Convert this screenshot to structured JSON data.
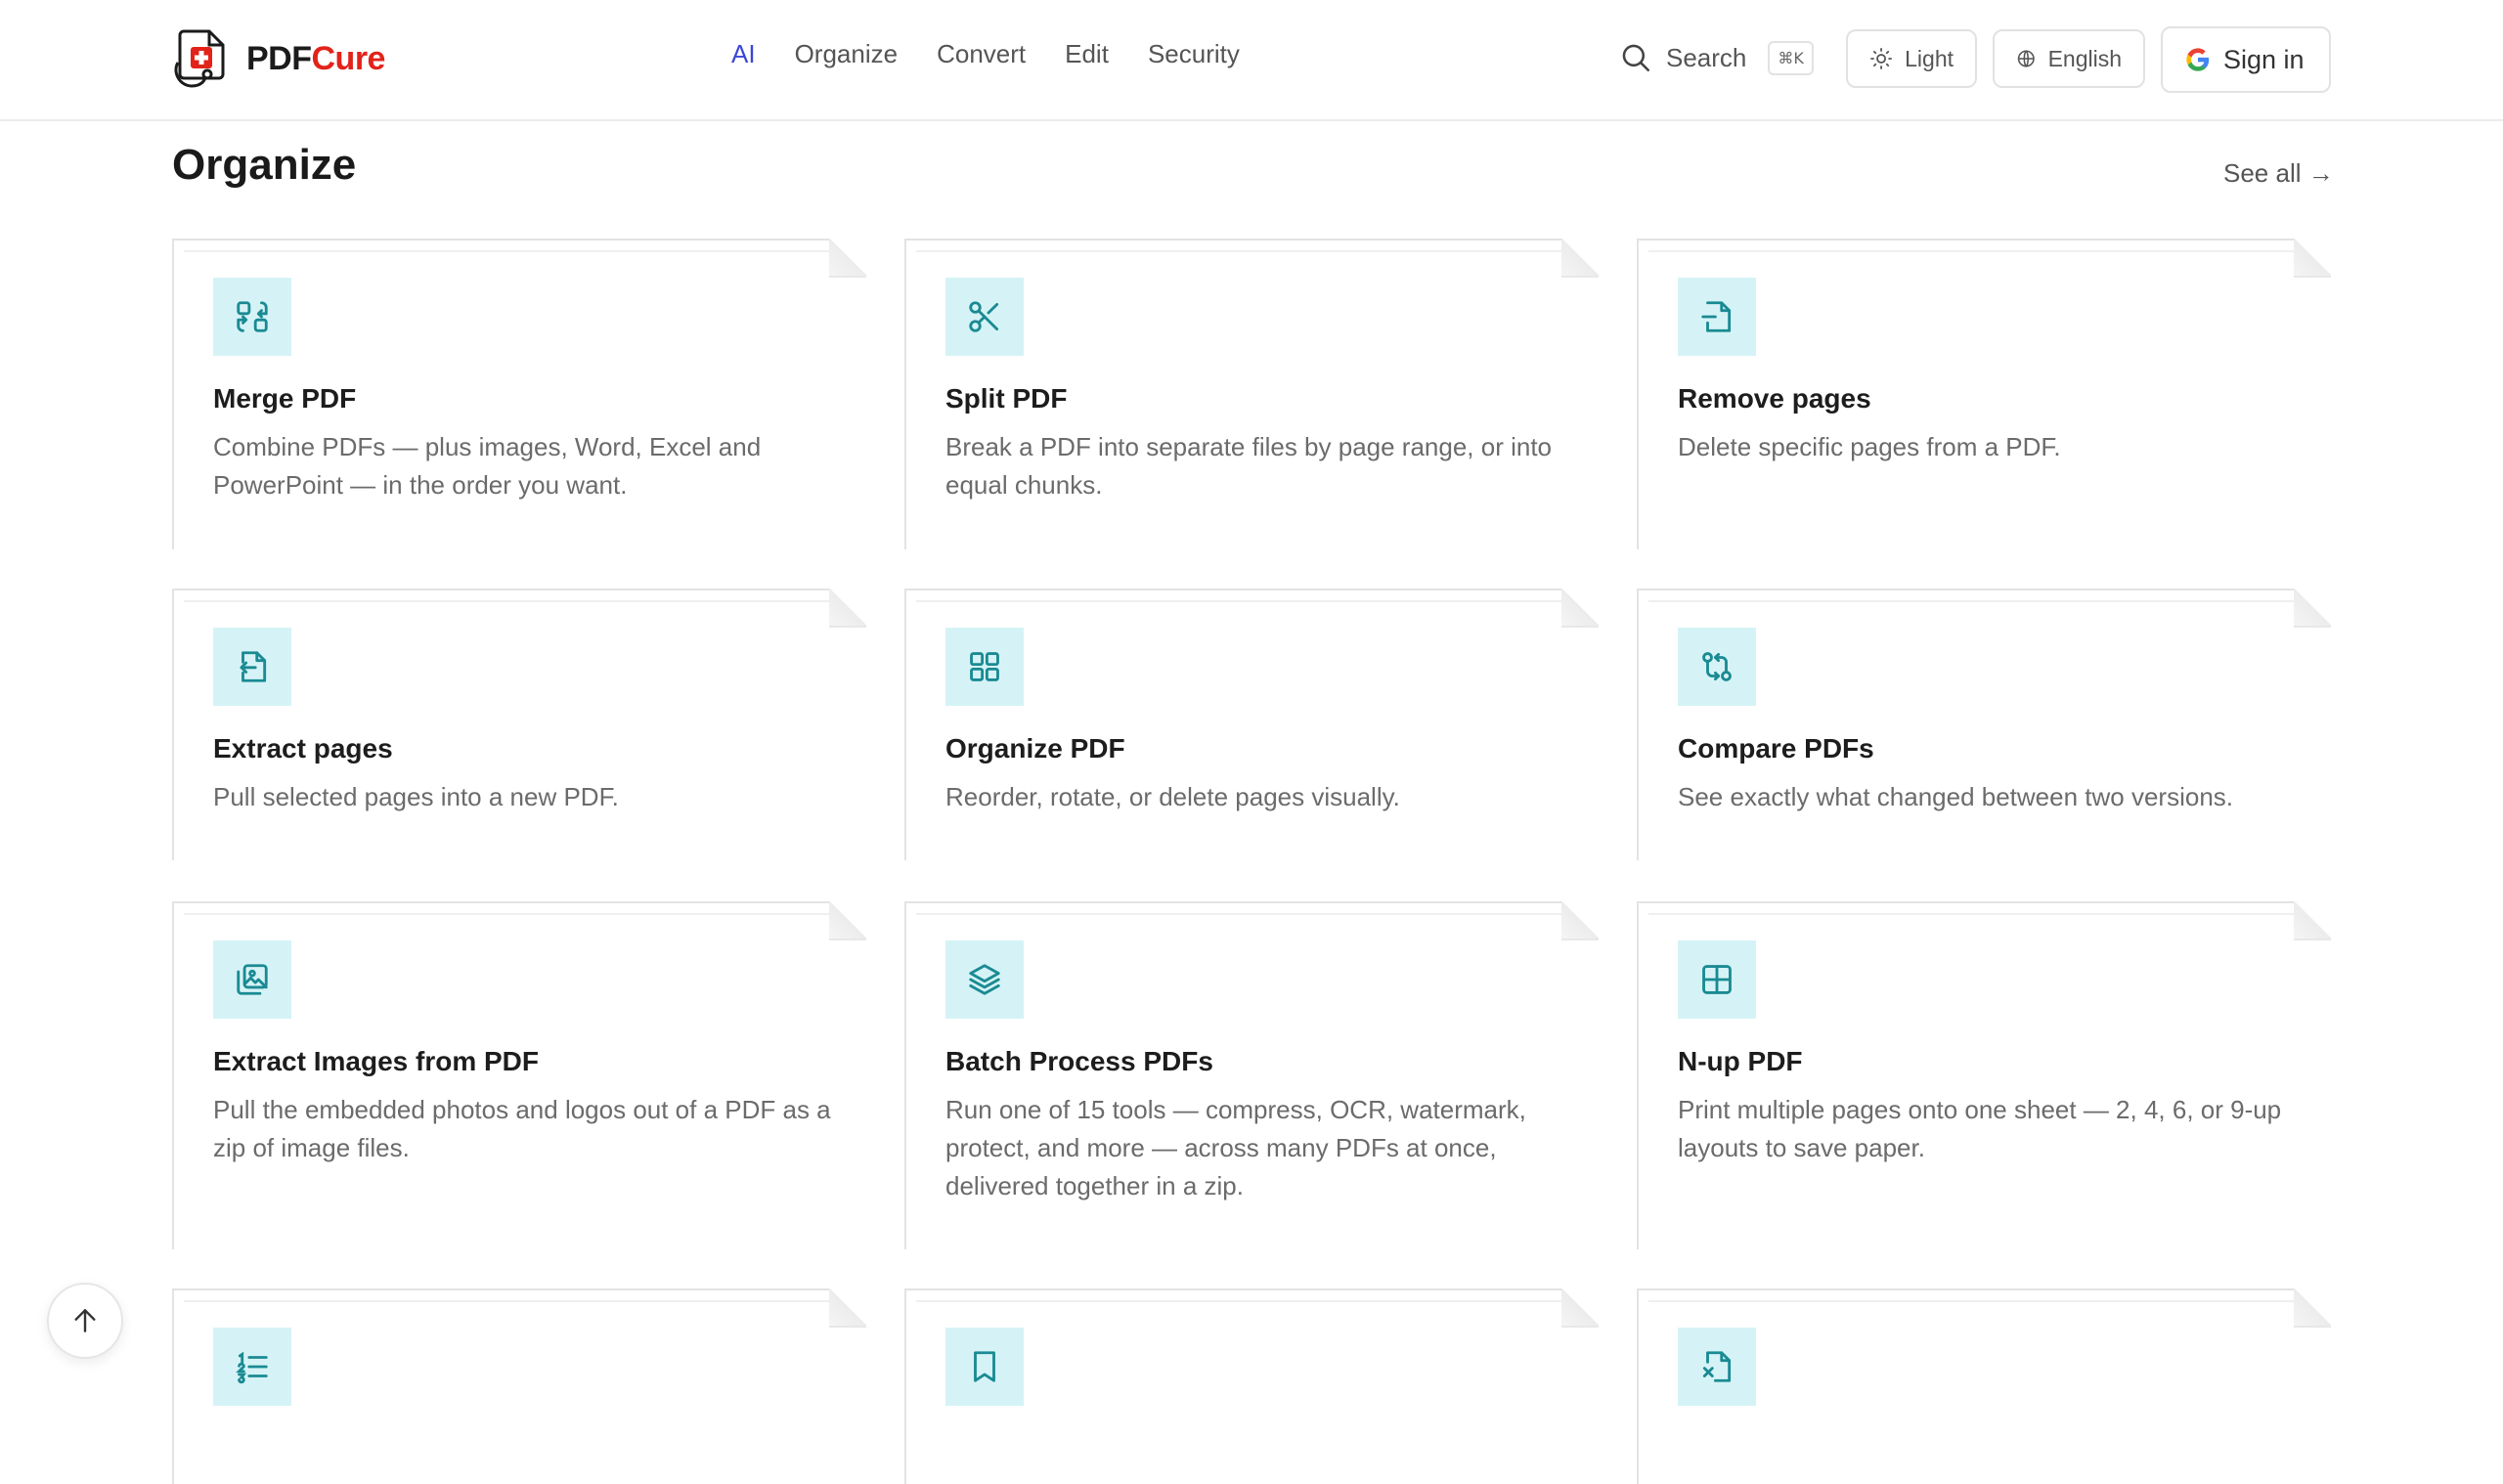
{
  "brand": {
    "part1": "PDF",
    "part2": "Cure",
    "accent": "#e2231a"
  },
  "nav": {
    "items": [
      "AI",
      "Organize",
      "Convert",
      "Edit",
      "Security"
    ],
    "active": "AI",
    "active_color": "#3b47d8"
  },
  "search": {
    "label": "Search",
    "shortcut": "⌘K"
  },
  "theme_toggle": {
    "label": "Light"
  },
  "language": {
    "label": "English"
  },
  "signin": {
    "label": "Sign in"
  },
  "section": {
    "title": "Organize",
    "see_all": "See all →"
  },
  "colors": {
    "icon_bg": "#d5f3f6",
    "icon_fg": "#1a8a93"
  },
  "cards": [
    {
      "icon": "merge-icon",
      "title": "Merge PDF",
      "desc": "Combine PDFs — plus images, Word, Excel and PowerPoint — in the order you want."
    },
    {
      "icon": "scissors-icon",
      "title": "Split PDF",
      "desc": "Break a PDF into separate files by page range, or into equal chunks."
    },
    {
      "icon": "file-minus-icon",
      "title": "Remove pages",
      "desc": "Delete specific pages from a PDF."
    },
    {
      "icon": "file-export-icon",
      "title": "Extract pages",
      "desc": "Pull selected pages into a new PDF."
    },
    {
      "icon": "grid-icon",
      "title": "Organize PDF",
      "desc": "Reorder, rotate, or delete pages visually."
    },
    {
      "icon": "compare-icon",
      "title": "Compare PDFs",
      "desc": "See exactly what changed between two versions."
    },
    {
      "icon": "images-icon",
      "title": "Extract Images from PDF",
      "desc": "Pull the embedded photos and logos out of a PDF as a zip of image files."
    },
    {
      "icon": "layers-icon",
      "title": "Batch Process PDFs",
      "desc": "Run one of 15 tools — compress, OCR, watermark, protect, and more — across many PDFs at once, delivered together in a zip."
    },
    {
      "icon": "layout-grid-icon",
      "title": "N-up PDF",
      "desc": "Print multiple pages onto one sheet — 2, 4, 6, or 9-up layouts to save paper."
    },
    {
      "icon": "list-ordered-icon",
      "title": "",
      "desc": ""
    },
    {
      "icon": "bookmark-icon",
      "title": "",
      "desc": ""
    },
    {
      "icon": "file-x-icon",
      "title": "",
      "desc": ""
    }
  ]
}
